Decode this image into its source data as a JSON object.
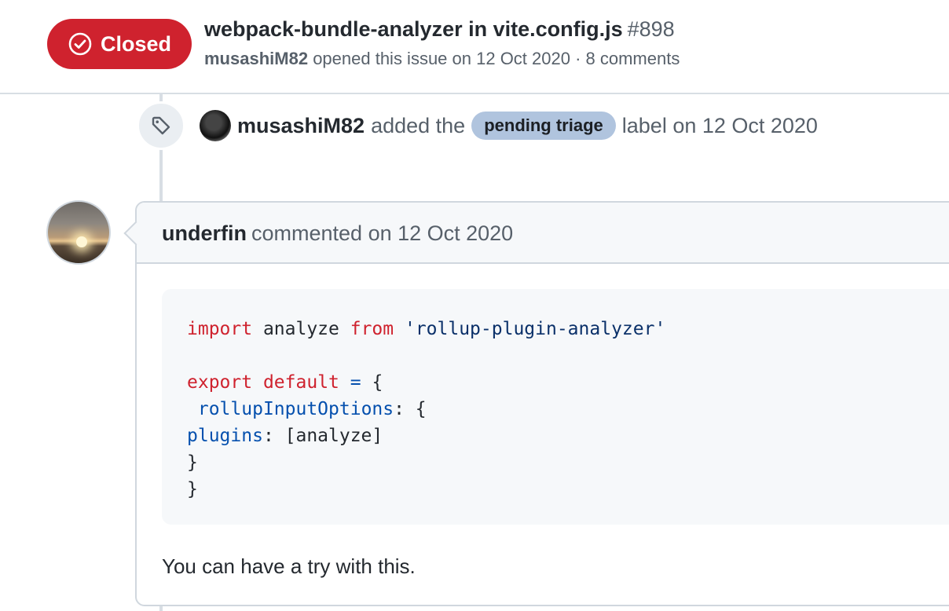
{
  "issue": {
    "state": "Closed",
    "title": "webpack-bundle-analyzer in vite.config.js",
    "number": "#898",
    "author": "musashiM82",
    "opened_text": "opened this issue on 12 Oct 2020 · 8 comments"
  },
  "label_event": {
    "icon": "tag-icon",
    "user": "musashiM82",
    "action": "added the",
    "label": "pending triage",
    "suffix": "label on 12 Oct 2020"
  },
  "comment": {
    "author": "underfin",
    "meta": "commented on 12 Oct 2020",
    "code": {
      "line1_kw1": "import",
      "line1_mid": " analyze ",
      "line1_kw2": "from",
      "line1_str": "'rollup-plugin-analyzer'",
      "line3_kw1": "export",
      "line3_kw2": "default",
      "line3_op": "=",
      "line3_brace": "{",
      "line4_prop": "rollupInputOptions",
      "line4_rest": ": {",
      "line5_prop": "plugins",
      "line5_rest": ": [analyze]",
      "line6": "}",
      "line7": "}"
    },
    "body": "You can have a try with this."
  },
  "colors": {
    "closed": "#cf222e",
    "label_bg": "#b0c4de",
    "keyword": "#cf222e",
    "string": "#0a3069",
    "property": "#0550ae"
  }
}
